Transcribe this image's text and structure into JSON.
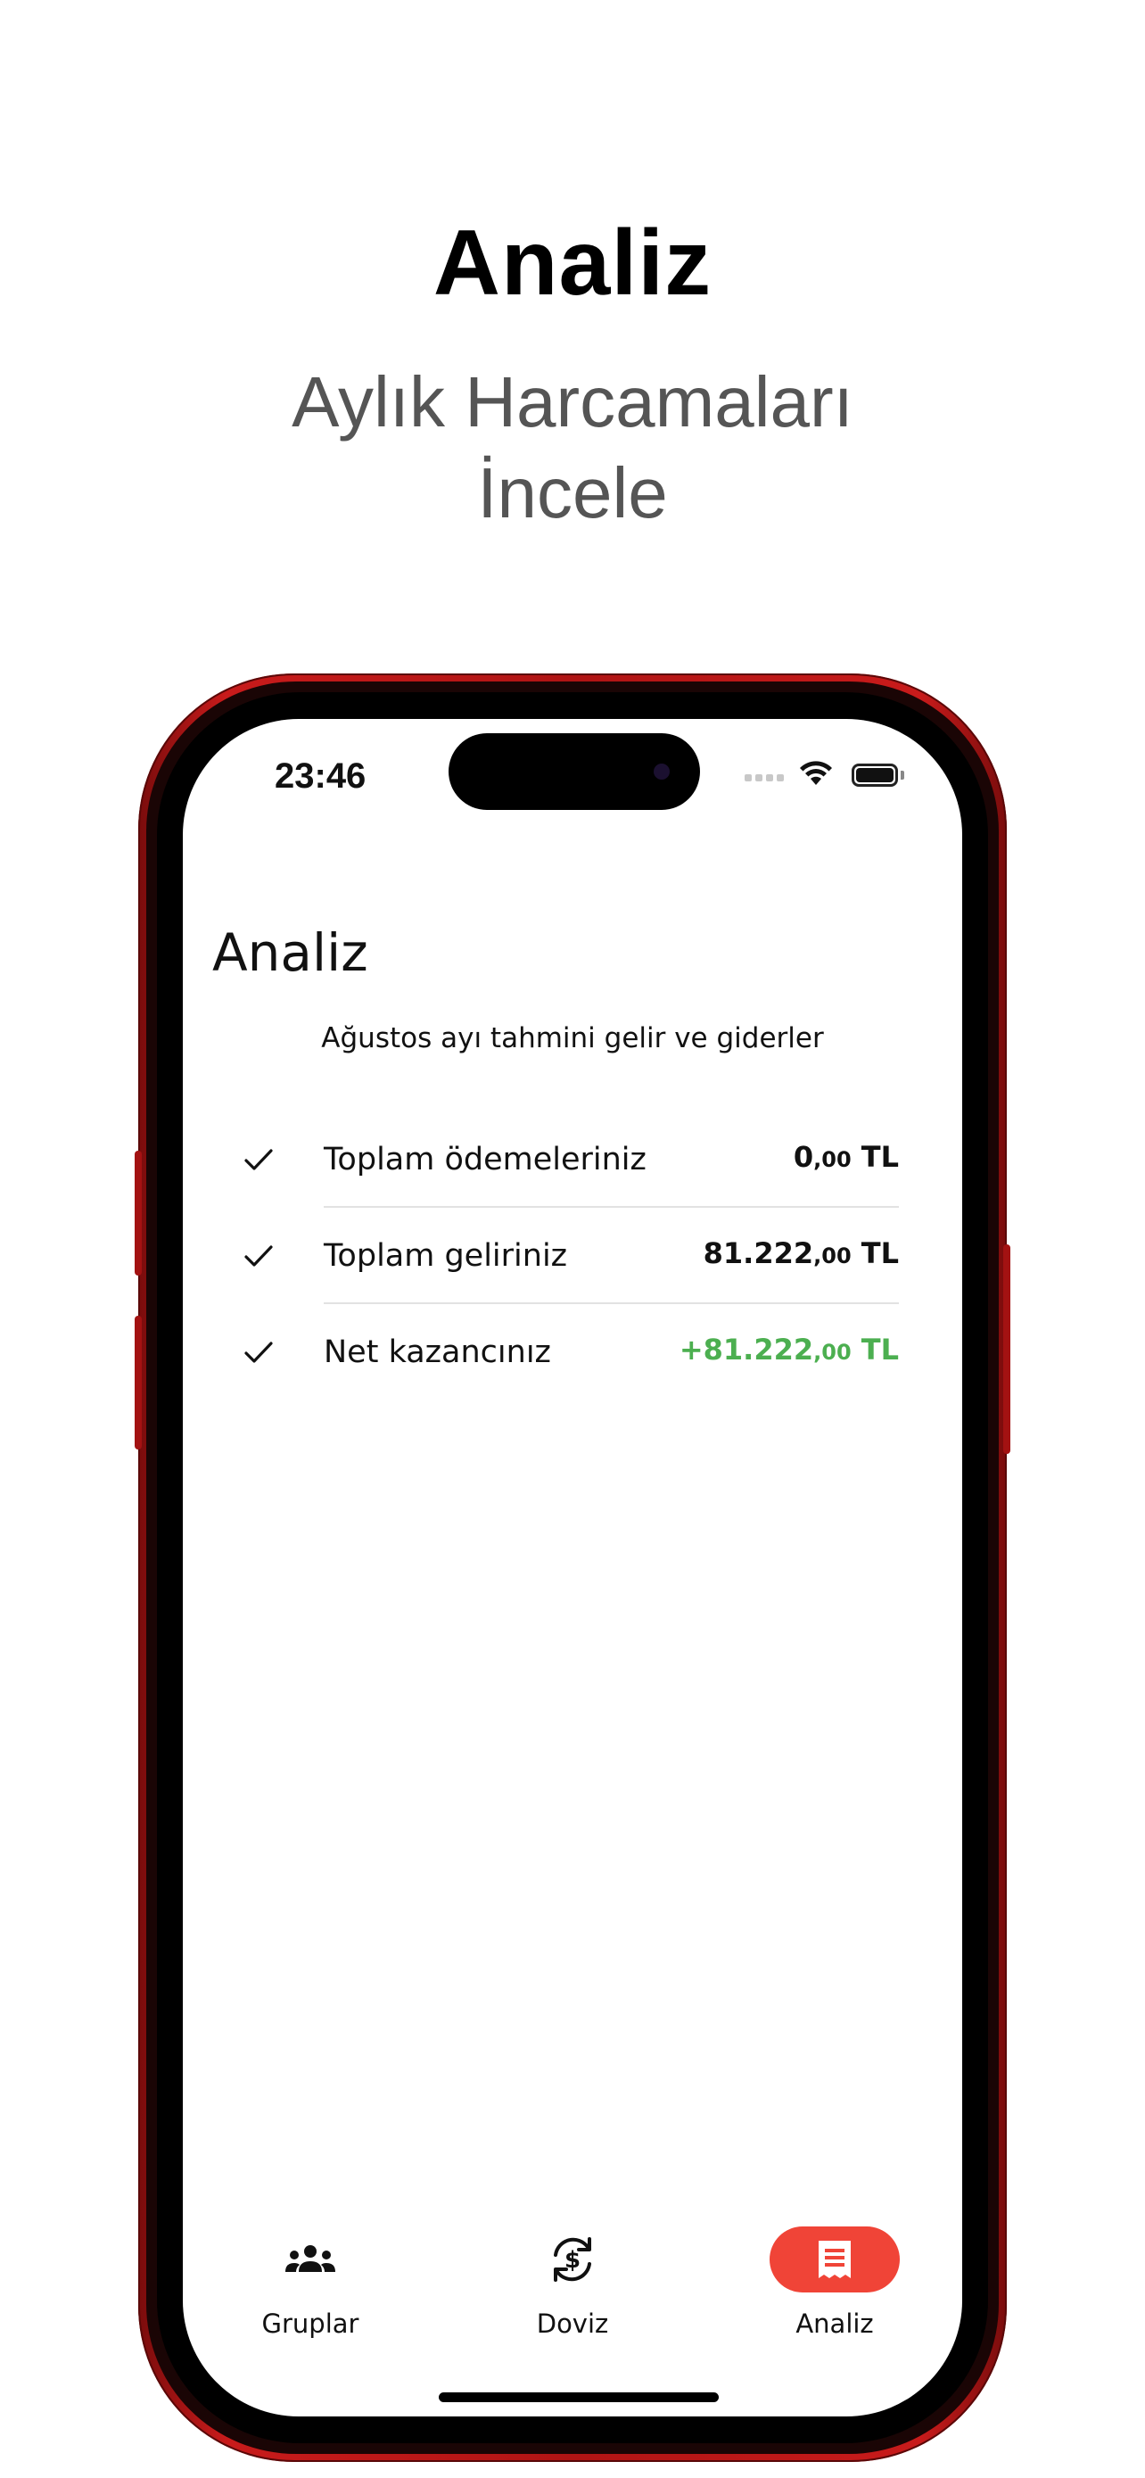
{
  "hero": {
    "title": "Analiz",
    "subtitle_line1": "Aylık Harcamaları",
    "subtitle_line2": "İncele"
  },
  "status_bar": {
    "time": "23:46"
  },
  "screen": {
    "title": "Analiz",
    "subtitle": "Ağustos ayı tahmini gelir ve giderler",
    "rows": [
      {
        "label": "Toplam ödemeleriniz",
        "amount_int": "0",
        "amount_dec": ",00",
        "currency": " TL"
      },
      {
        "label": "Toplam geliriniz",
        "amount_int": "81.222",
        "amount_dec": ",00",
        "currency": " TL"
      },
      {
        "label": "Net kazancınız",
        "amount_int": "+81.222",
        "amount_dec": ",00",
        "currency": " TL"
      }
    ]
  },
  "tabs": [
    {
      "label": "Gruplar",
      "icon": "group-icon",
      "active": false
    },
    {
      "label": "Doviz",
      "icon": "currency-exchange-icon",
      "active": false
    },
    {
      "label": "Analiz",
      "icon": "receipt-icon",
      "active": true
    }
  ],
  "colors": {
    "accent": "#f04437",
    "positive": "#4caf50",
    "phone_frame": "#b01414"
  }
}
